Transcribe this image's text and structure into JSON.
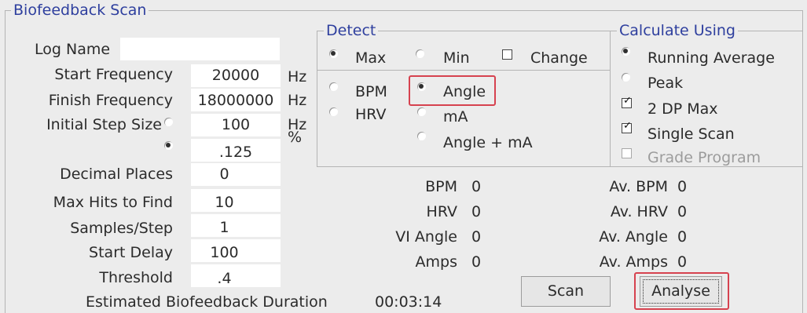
{
  "title": "Biofeedback Scan",
  "log_name": {
    "label": "Log Name",
    "value": ""
  },
  "params": [
    {
      "label": "Start Frequency",
      "value": "20000",
      "unit": "Hz"
    },
    {
      "label": "Finish Frequency",
      "value": "18000000",
      "unit": "Hz"
    },
    {
      "label": "Initial Step Size",
      "value": "100",
      "unit": "Hz"
    },
    {
      "label": "",
      "value": ".125",
      "unit": "%"
    },
    {
      "label": "Decimal Places",
      "value": "0"
    },
    {
      "label": "Max Hits to Find",
      "value": "10"
    },
    {
      "label": "Samples/Step",
      "value": "1"
    },
    {
      "label": "Start Delay",
      "value": "100"
    },
    {
      "label": "Threshold",
      "value": ".4"
    }
  ],
  "step_mode": {
    "selected": "percent"
  },
  "detect": {
    "title": "Detect",
    "max": "Max",
    "min": "Min",
    "change": "Change",
    "bpm": "BPM",
    "hrv": "HRV",
    "angle": "Angle",
    "ma": "mA",
    "angle_ma": "Angle + mA",
    "selected_extreme": "Max",
    "selected_measure": "Angle"
  },
  "calculate": {
    "title": "Calculate Using",
    "running_average": "Running Average",
    "peak": "Peak",
    "two_dp_max": "2 DP Max",
    "single_scan": "Single Scan",
    "grade_program": "Grade Program"
  },
  "readings": [
    {
      "label": "BPM",
      "value": "0"
    },
    {
      "label": "HRV",
      "value": "0"
    },
    {
      "label": "VI Angle",
      "value": "0"
    },
    {
      "label": "Amps",
      "value": "0"
    }
  ],
  "averages": [
    {
      "label": "Av. BPM",
      "value": "0"
    },
    {
      "label": "Av. HRV",
      "value": "0"
    },
    {
      "label": "Av. Angle",
      "value": "0"
    },
    {
      "label": "Av. Amps",
      "value": "0"
    }
  ],
  "duration": {
    "label": "Estimated Biofeedback Duration",
    "value": "00:03:14"
  },
  "buttons": {
    "scan": "Scan",
    "analyse": "Analyse"
  }
}
